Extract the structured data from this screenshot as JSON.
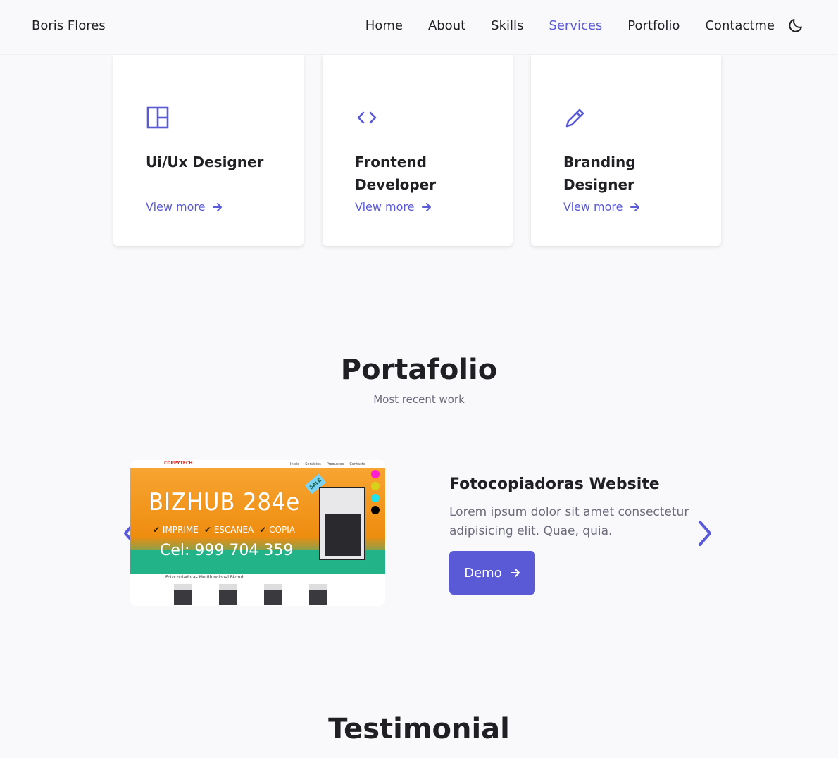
{
  "header": {
    "logo": "Boris Flores",
    "nav": [
      "Home",
      "About",
      "Skills",
      "Services",
      "Portfolio",
      "Contactme"
    ],
    "active": "Services",
    "theme_icon": "moon-icon"
  },
  "services": [
    {
      "title": "Ui/Ux Designer",
      "link": "View more",
      "icon": "layout-icon"
    },
    {
      "title": "Frontend Developer",
      "link": "View more",
      "icon": "code-icon"
    },
    {
      "title": "Branding Designer",
      "link": "View more",
      "icon": "pencil-icon"
    }
  ],
  "portfolio": {
    "title": "Portafolio",
    "subtitle": "Most recent work",
    "project": {
      "title": "Fotocopiadoras Website",
      "description": "Lorem ipsum dolor sit amet consectetur adipisicing elit. Quae, quia.",
      "button": "Demo",
      "screenshot": {
        "brand": "COPPYTECH",
        "nav": [
          "Inicio",
          "Servicios",
          "Productos",
          "Contacto"
        ],
        "headline": "BIZHUB 284e",
        "checks": [
          "IMPRIME",
          "ESCANEA",
          "COPIA"
        ],
        "phone": "Cel: 999 704 359",
        "sale": "SALE",
        "lower_title": "Fotocopiadoras Multifuncional Bizhub",
        "dot_colors": [
          "#ff1fd0",
          "#d6d21a",
          "#1fe3f0",
          "#000000"
        ]
      }
    }
  },
  "testimonial": {
    "title": "Testimonial"
  },
  "colors": {
    "accent": "#5a5ad6",
    "text": "#1f1f24",
    "muted": "#6b6b7b"
  }
}
